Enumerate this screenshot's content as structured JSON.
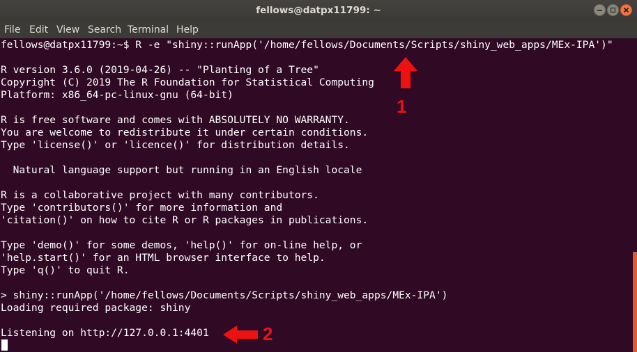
{
  "window": {
    "title": "fellows@datpx11799: ~",
    "minimize_icon": "minimize-icon",
    "maximize_icon": "maximize-icon",
    "close_icon": "close-icon"
  },
  "menu": {
    "items": [
      "File",
      "Edit",
      "View",
      "Search",
      "Terminal",
      "Help"
    ]
  },
  "terminal": {
    "lines": [
      "fellows@datpx11799:~$ R -e \"shiny::runApp('/home/fellows/Documents/Scripts/shiny_web_apps/MEx-IPA')\"",
      "",
      "R version 3.6.0 (2019-04-26) -- \"Planting of a Tree\"",
      "Copyright (C) 2019 The R Foundation for Statistical Computing",
      "Platform: x86_64-pc-linux-gnu (64-bit)",
      "",
      "R is free software and comes with ABSOLUTELY NO WARRANTY.",
      "You are welcome to redistribute it under certain conditions.",
      "Type 'license()' or 'licence()' for distribution details.",
      "",
      "  Natural language support but running in an English locale",
      "",
      "R is a collaborative project with many contributors.",
      "Type 'contributors()' for more information and",
      "'citation()' on how to cite R or R packages in publications.",
      "",
      "Type 'demo()' for some demos, 'help()' for on-line help, or",
      "'help.start()' for an HTML browser interface to help.",
      "Type 'q()' to quit R.",
      "",
      "> shiny::runApp('/home/fellows/Documents/Scripts/shiny_web_apps/MEx-IPA')",
      "Loading required package: shiny",
      "",
      "Listening on http://127.0.0.1:4401"
    ]
  },
  "annotations": {
    "arrow1_label": "1",
    "arrow2_label": "2",
    "color": "#ee1111"
  }
}
